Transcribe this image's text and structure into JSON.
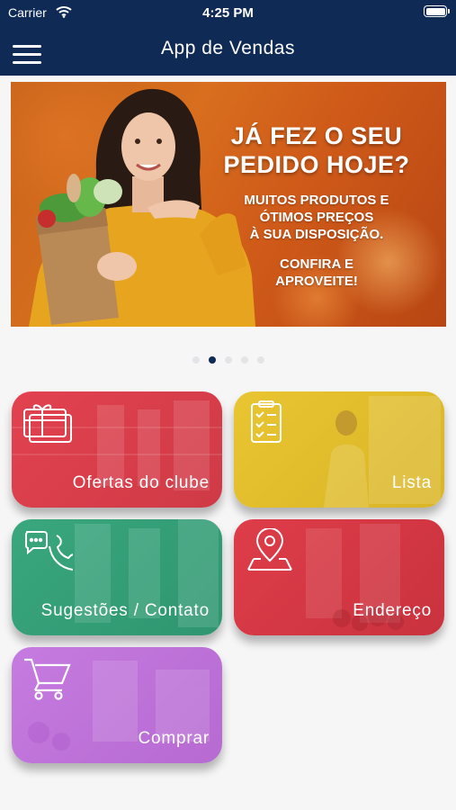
{
  "status_bar": {
    "carrier": "Carrier",
    "time": "4:25 PM"
  },
  "header": {
    "title": "App de Vendas",
    "menu_icon": "hamburger-menu-icon"
  },
  "banner": {
    "headline_line1": "JÁ FEZ O SEU",
    "headline_line2": "PEDIDO HOJE?",
    "sub_line1": "MUITOS PRODUTOS E",
    "sub_line2": "ÓTIMOS PREÇOS",
    "sub_line3": "À SUA DISPOSIÇÃO.",
    "cta_line1": "CONFIRA E",
    "cta_line2": "APROVEITE!"
  },
  "carousel": {
    "slide_count": 5,
    "active_index": 1
  },
  "tiles": [
    {
      "label": "Ofertas do clube",
      "icon": "gift-card-icon",
      "color": "#e2424f"
    },
    {
      "label": "Lista",
      "icon": "clipboard-checklist-icon",
      "color": "#e9c532"
    },
    {
      "label": "Sugestões / Contato",
      "icon": "phone-chat-icon",
      "color": "#3aa77e"
    },
    {
      "label": "Endereço",
      "icon": "map-pin-icon",
      "color": "#de3d49"
    },
    {
      "label": "Comprar",
      "icon": "shopping-cart-icon",
      "color": "#c67be0"
    }
  ],
  "colors": {
    "header": "#0f2a55",
    "background": "#f6f6f7",
    "active_dot": "#0f2a55"
  }
}
